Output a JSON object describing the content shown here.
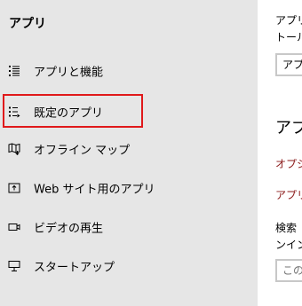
{
  "sidebar": {
    "title": "アプリ",
    "items": [
      {
        "label": "アプリと機能",
        "icon": "apps-list-icon"
      },
      {
        "label": "既定のアプリ",
        "icon": "default-apps-icon"
      },
      {
        "label": "オフライン マップ",
        "icon": "offline-maps-icon"
      },
      {
        "label": "Web サイト用のアプリ",
        "icon": "apps-for-websites-icon"
      },
      {
        "label": "ビデオの再生",
        "icon": "video-playback-icon"
      },
      {
        "label": "スタートアップ",
        "icon": "startup-icon"
      }
    ],
    "selected_index": 1,
    "selected_outline_color": "#e0191b"
  },
  "content": {
    "text_line1": "アプリ",
    "text_line2": "トール",
    "dropdown_value": "アプ",
    "heading": "アプリ",
    "link1": "オプシ",
    "link2": "アプリ",
    "search_text1": "検索",
    "search_text2": "ンイン",
    "search_placeholder": "この",
    "link_color": "#8b1a1a"
  }
}
